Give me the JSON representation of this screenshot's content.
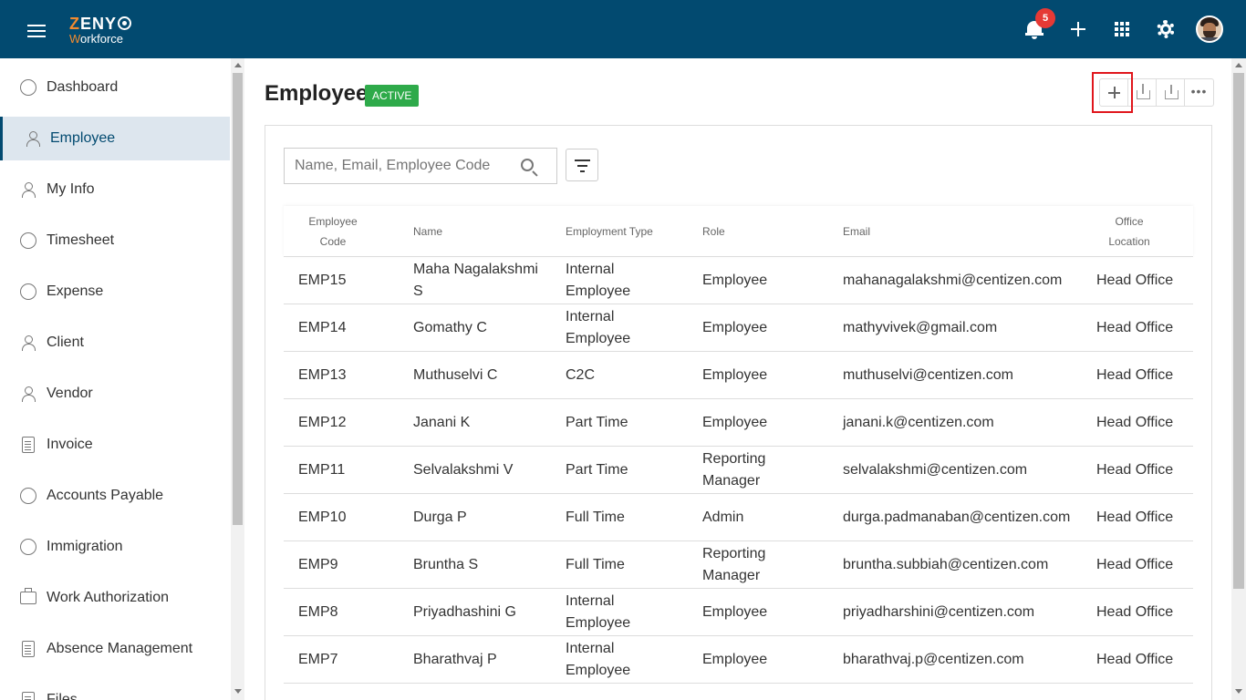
{
  "header": {
    "logo_brand": "ZENYO",
    "logo_sub": "Workforce",
    "notification_count": "5"
  },
  "sidebar": {
    "items": [
      {
        "label": "Dashboard"
      },
      {
        "label": "Employee"
      },
      {
        "label": "My Info"
      },
      {
        "label": "Timesheet"
      },
      {
        "label": "Expense"
      },
      {
        "label": "Client"
      },
      {
        "label": "Vendor"
      },
      {
        "label": "Invoice"
      },
      {
        "label": "Accounts Payable"
      },
      {
        "label": "Immigration"
      },
      {
        "label": "Work Authorization"
      },
      {
        "label": "Absence Management"
      },
      {
        "label": "Files"
      }
    ]
  },
  "page": {
    "title": "Employee",
    "status": "ACTIVE",
    "search_placeholder": "Name, Email, Employee Code"
  },
  "table": {
    "headers": {
      "code_line1": "Employee",
      "code_line2": "Code",
      "name": "Name",
      "type": "Employment Type",
      "role": "Role",
      "email": "Email",
      "office_line1": "Office",
      "office_line2": "Location"
    },
    "rows": [
      {
        "code": "EMP15",
        "name": "Maha Nagalakshmi S",
        "type": "Internal Employee",
        "role": "Employee",
        "email": "mahanagalakshmi@centizen.com",
        "office": "Head Office"
      },
      {
        "code": "EMP14",
        "name": "Gomathy C",
        "type": "Internal Employee",
        "role": "Employee",
        "email": "mathyvivek@gmail.com",
        "office": "Head Office"
      },
      {
        "code": "EMP13",
        "name": "Muthuselvi C",
        "type": "C2C",
        "role": "Employee",
        "email": "muthuselvi@centizen.com",
        "office": "Head Office"
      },
      {
        "code": "EMP12",
        "name": "Janani K",
        "type": "Part Time",
        "role": "Employee",
        "email": "janani.k@centizen.com",
        "office": "Head Office"
      },
      {
        "code": "EMP11",
        "name": "Selvalakshmi V",
        "type": "Part Time",
        "role": "Reporting Manager",
        "email": "selvalakshmi@centizen.com",
        "office": "Head Office"
      },
      {
        "code": "EMP10",
        "name": "Durga P",
        "type": "Full Time",
        "role": "Admin",
        "email": "durga.padmanaban@centizen.com",
        "office": "Head Office"
      },
      {
        "code": "EMP9",
        "name": "Bruntha S",
        "type": "Full Time",
        "role": "Reporting Manager",
        "email": "bruntha.subbiah@centizen.com",
        "office": "Head Office"
      },
      {
        "code": "EMP8",
        "name": "Priyadhashini G",
        "type": "Internal Employee",
        "role": "Employee",
        "email": "priyadharshini@centizen.com",
        "office": "Head Office"
      },
      {
        "code": "EMP7",
        "name": "Bharathvaj P",
        "type": "Internal Employee",
        "role": "Employee",
        "email": "bharathvaj.p@centizen.com",
        "office": "Head Office"
      }
    ]
  },
  "colors": {
    "header_bg": "#024a70",
    "active_badge": "#2eaa4a",
    "notification_badge": "#e53935",
    "highlight_box": "#e0161c",
    "logo_accent": "#f28b30"
  }
}
